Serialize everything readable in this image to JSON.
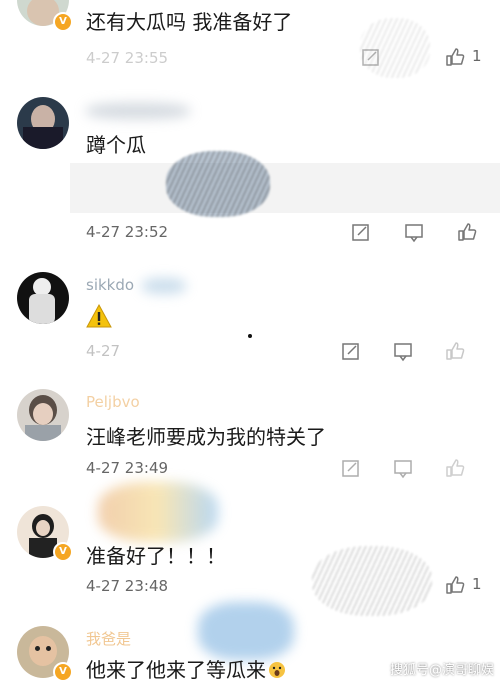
{
  "comments": [
    {
      "username": "",
      "text": "还有大瓜吗 我准备好了",
      "time": "4-27 23:55",
      "likes": "1"
    },
    {
      "username": "",
      "text": "蹲个瓜",
      "time": "4-27 23:52",
      "likes": ""
    },
    {
      "username": "sikkdo",
      "text": "",
      "time": "4-27",
      "likes": ""
    },
    {
      "username": "Peljbvo",
      "text": "汪峰老师要成为我的特关了",
      "time": "4-27 23:49",
      "likes": ""
    },
    {
      "username": "",
      "text": "准备好了！！！",
      "time": "4-27 23:48",
      "likes": "1"
    },
    {
      "username": "我爸是",
      "text": "他来了他来了等瓜来",
      "time": "",
      "likes": ""
    }
  ],
  "watermark": "搜狐号@演哥聊娱",
  "colors": {
    "accent": "#f5a623",
    "meta": "#9a9a9a",
    "background": "#ffffff"
  },
  "icons": [
    "comment-reply-icon",
    "repost-icon",
    "like-thumb-icon",
    "warning-emoji-icon",
    "verified-badge-icon"
  ]
}
